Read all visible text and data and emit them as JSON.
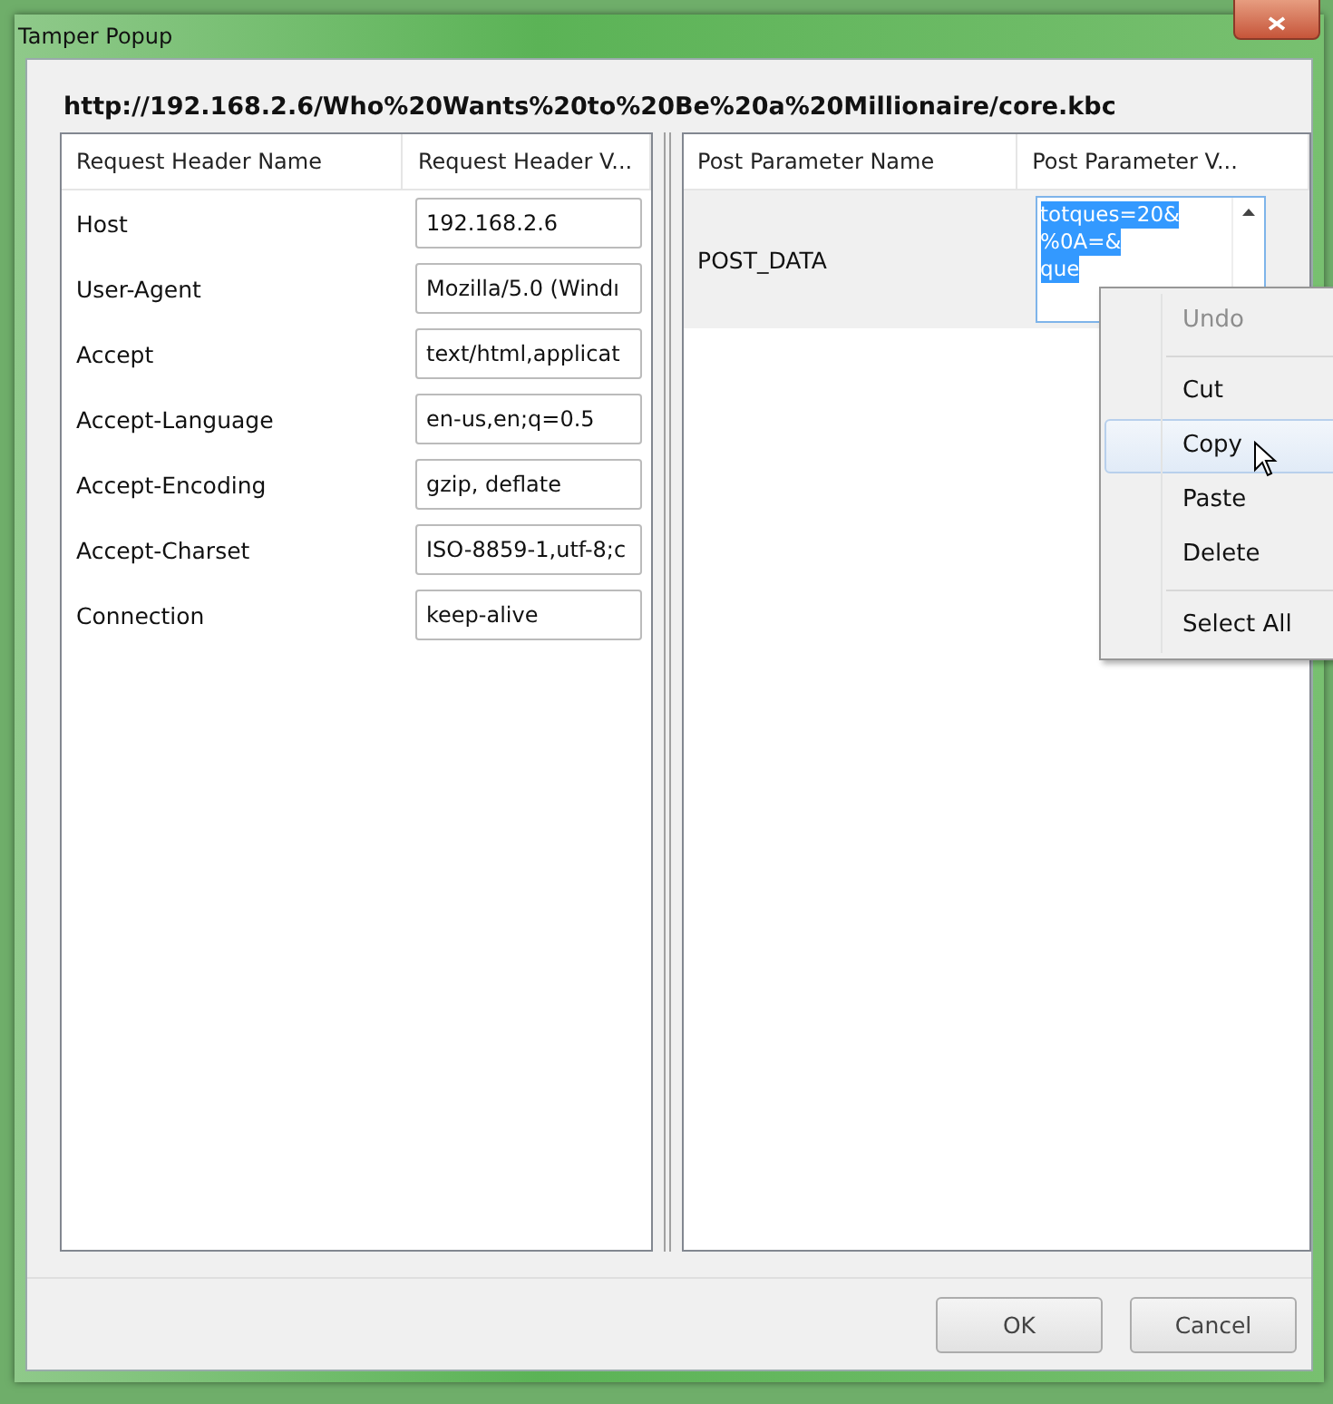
{
  "window": {
    "title": "Tamper Popup"
  },
  "url": "http://192.168.2.6/Who%20Wants%20to%20Be%20a%20Millionaire/core.kbc",
  "request_headers": {
    "columns": [
      "Request Header Name",
      "Request Header V..."
    ],
    "rows": [
      {
        "name": "Host",
        "value": "192.168.2.6"
      },
      {
        "name": "User-Agent",
        "value": "Mozilla/5.0 (Windı"
      },
      {
        "name": "Accept",
        "value": "text/html,applicat"
      },
      {
        "name": "Accept-Language",
        "value": "en-us,en;q=0.5"
      },
      {
        "name": "Accept-Encoding",
        "value": "gzip, deflate"
      },
      {
        "name": "Accept-Charset",
        "value": "ISO-8859-1,utf-8;c"
      },
      {
        "name": "Connection",
        "value": "keep-alive"
      }
    ]
  },
  "post_parameters": {
    "columns": [
      "Post Parameter Name",
      "Post Parameter V..."
    ],
    "rows": [
      {
        "name": "POST_DATA",
        "value_lines": [
          "totques=20&",
          "%0A=&",
          "que"
        ],
        "selected": true
      }
    ]
  },
  "context_menu": {
    "items": [
      {
        "kind": "item",
        "label": "Undo",
        "disabled": true,
        "selected": false
      },
      {
        "kind": "separator"
      },
      {
        "kind": "item",
        "label": "Cut",
        "disabled": false,
        "selected": false
      },
      {
        "kind": "item",
        "label": "Copy",
        "disabled": false,
        "selected": true
      },
      {
        "kind": "item",
        "label": "Paste",
        "disabled": false,
        "selected": false
      },
      {
        "kind": "item",
        "label": "Delete",
        "disabled": false,
        "selected": false
      },
      {
        "kind": "separator"
      },
      {
        "kind": "item",
        "label": "Select All",
        "disabled": false,
        "selected": false
      }
    ]
  },
  "buttons": [
    "OK",
    "Cancel"
  ]
}
